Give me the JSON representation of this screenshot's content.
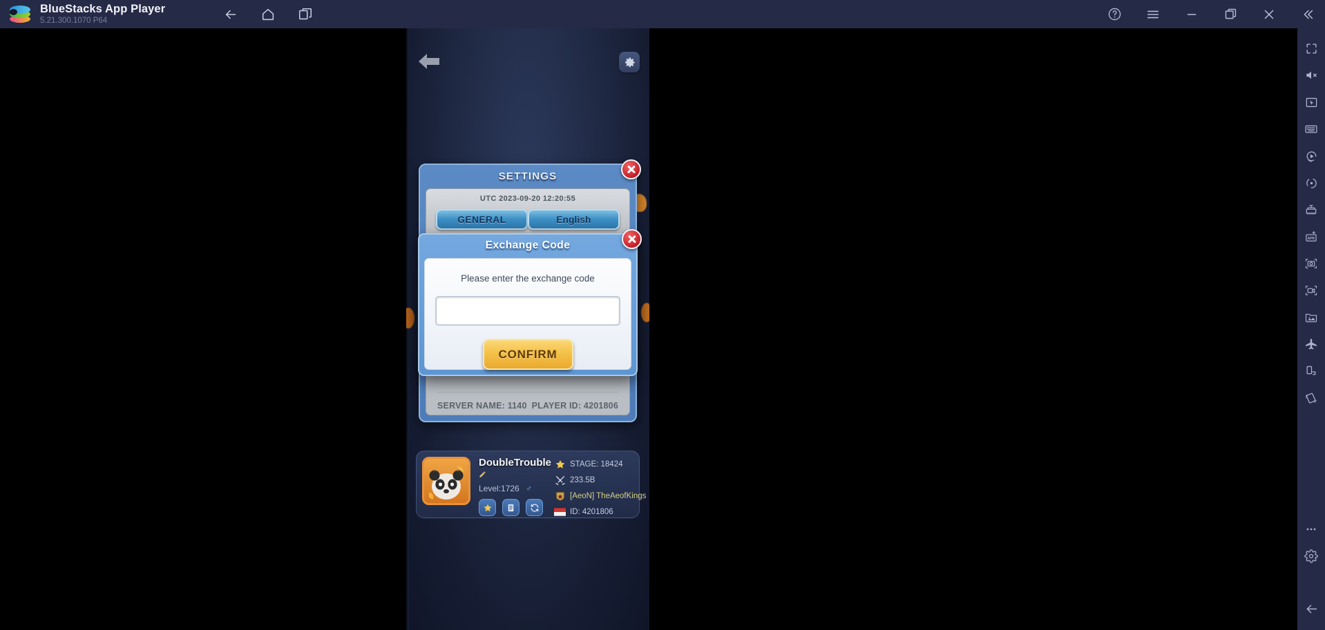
{
  "titlebar": {
    "app_name": "BlueStacks App Player",
    "version": "5.21.300.1070  P64",
    "logo_icon": "bluestacks-logo",
    "nav": [
      {
        "icon": "back-arrow-icon",
        "name": "back-button"
      },
      {
        "icon": "home-icon",
        "name": "home-button"
      },
      {
        "icon": "multi-instance-icon",
        "name": "multi-instance-button"
      }
    ],
    "right_controls": [
      {
        "icon": "help-circle-icon",
        "name": "help-button"
      },
      {
        "icon": "hamburger-menu-icon",
        "name": "menu-button"
      },
      {
        "icon": "minimize-icon",
        "name": "minimize-button"
      },
      {
        "icon": "restore-icon",
        "name": "restore-button"
      },
      {
        "icon": "close-icon",
        "name": "close-button"
      },
      {
        "icon": "collapse-left-icon",
        "name": "collapse-button"
      }
    ]
  },
  "sidebar": {
    "items": [
      {
        "icon": "fullscreen-icon",
        "name": "fullscreen-button"
      },
      {
        "icon": "mute-icon",
        "name": "mute-button"
      },
      {
        "icon": "cursor-screen-icon",
        "name": "game-controls-button"
      },
      {
        "icon": "keyboard-icon",
        "name": "keymapping-button"
      },
      {
        "icon": "macro-play-icon",
        "name": "macro-button"
      },
      {
        "icon": "gyroscope-icon",
        "name": "gyroscope-button"
      },
      {
        "icon": "multi-instance-manager-icon",
        "name": "instance-manager-button"
      },
      {
        "icon": "apk-install-icon",
        "name": "install-apk-button"
      },
      {
        "icon": "screenshot-icon",
        "name": "screenshot-button"
      },
      {
        "icon": "record-video-icon",
        "name": "record-screen-button"
      },
      {
        "icon": "media-manager-icon",
        "name": "media-manager-button"
      },
      {
        "icon": "airplane-icon",
        "name": "eco-mode-button"
      },
      {
        "icon": "rotate-screen-icon",
        "name": "rotate-button"
      },
      {
        "icon": "shake-icon",
        "name": "shake-button"
      },
      {
        "icon": "more-dots-icon",
        "name": "more-button"
      },
      {
        "icon": "gear-icon",
        "name": "settings-button"
      },
      {
        "icon": "back-arrow-icon",
        "name": "back-nav-button"
      }
    ]
  },
  "game": {
    "top_bar": {
      "back_icon": "back-arrow-icon",
      "settings_icon": "gear-icon"
    },
    "settings_dialog": {
      "title": "SETTINGS",
      "close_icon": "close-x-icon",
      "utc_time": "UTC 2023-09-20 12:20:55",
      "buttons": [
        {
          "label": "GENERAL",
          "name": "general-button"
        },
        {
          "label": "English",
          "name": "language-button"
        }
      ],
      "footer": {
        "server_name": "SERVER NAME: 1140",
        "player_id": "PLAYER ID: 4201806"
      }
    },
    "exchange_dialog": {
      "title": "Exchange Code",
      "close_icon": "close-x-icon",
      "prompt": "Please enter the exchange code",
      "input_value": "",
      "input_placeholder": "",
      "confirm_label": "CONFIRM"
    },
    "player_panel": {
      "name": "DoubleTrouble",
      "edit_icon": "pencil-icon",
      "level": "Level:1726",
      "gender_icon": "male-symbol",
      "gender": "♂",
      "action_icons": [
        {
          "icon": "star-icon",
          "name": "achievements-button"
        },
        {
          "icon": "list-icon",
          "name": "mail-button"
        },
        {
          "icon": "refresh-icon",
          "name": "refresh-button"
        }
      ],
      "stats": [
        {
          "icon": "star-icon",
          "text": "STAGE: 18424",
          "name": "stat-stage"
        },
        {
          "icon": "swords-icon",
          "text": "233.5B",
          "name": "stat-power"
        },
        {
          "icon": "guild-icon",
          "text": "[AeoN] TheAeofKings",
          "name": "stat-guild"
        },
        {
          "icon": "flag-icon",
          "text": "ID: 4201806",
          "name": "stat-id"
        }
      ]
    }
  },
  "colors": {
    "titlebar_bg": "#252a47",
    "sidebar_bg": "#252a47",
    "accent_blue": "#5b8ac4",
    "confirm_yellow": "#f5c14a",
    "close_red": "#c8232c"
  }
}
